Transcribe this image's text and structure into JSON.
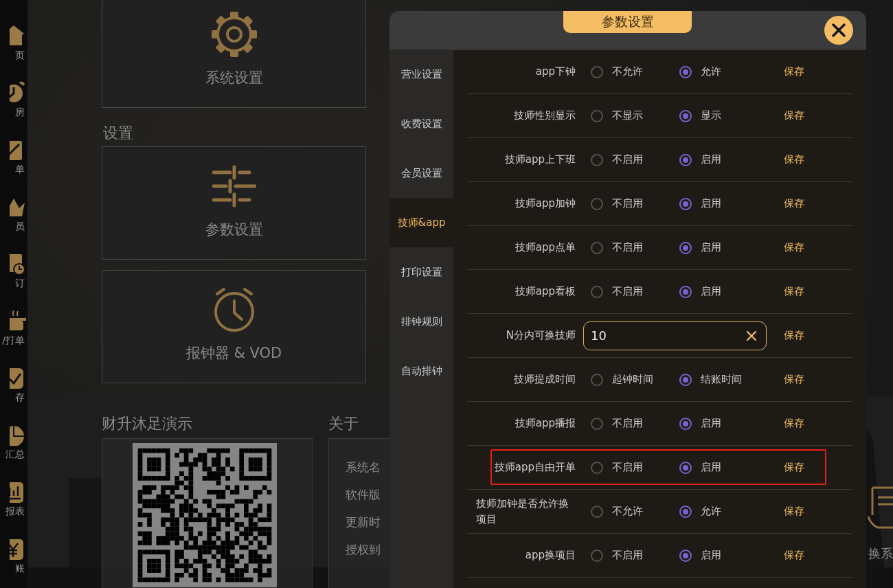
{
  "nav": [
    {
      "kind": "home",
      "label": "页"
    },
    {
      "kind": "clock",
      "label": "房"
    },
    {
      "kind": "clipboard",
      "label": "单"
    },
    {
      "kind": "crown",
      "label": "员"
    },
    {
      "kind": "calendar",
      "label": "订"
    },
    {
      "kind": "pot",
      "label": "/打单"
    },
    {
      "kind": "check",
      "label": "存"
    },
    {
      "kind": "pie",
      "label": "汇总"
    },
    {
      "kind": "report",
      "label": "报表"
    },
    {
      "kind": "yen",
      "label": "账"
    }
  ],
  "groups": [
    {
      "tiles": [
        {
          "kind": "gear",
          "label": "系统设置"
        }
      ]
    },
    {
      "title": "设置",
      "tiles": [
        {
          "kind": "sliders",
          "label": "参数设置"
        },
        {
          "kind": "alarm",
          "label": "报钟器 & VOD"
        }
      ]
    }
  ],
  "demo": {
    "title": "财升沐足演示"
  },
  "about": {
    "title": "关于",
    "lines": [
      "系统名",
      "软件版",
      "更新时",
      "授权到"
    ]
  },
  "edge_tile": {
    "label": "换系"
  },
  "dialog": {
    "title": "参数设置",
    "tabs": [
      {
        "label": "营业设置",
        "selected": false
      },
      {
        "label": "收费设置",
        "selected": false
      },
      {
        "label": "会员设置",
        "selected": false
      },
      {
        "label": "技师&app",
        "selected": true
      },
      {
        "label": "打印设置",
        "selected": false
      },
      {
        "label": "排钟规则",
        "selected": false
      },
      {
        "label": "自动排钟",
        "selected": false
      }
    ],
    "rows": [
      {
        "kind": "radio",
        "label": "app下钟",
        "options": [
          {
            "label": "不允许",
            "selected": false
          },
          {
            "label": "允许",
            "selected": true
          }
        ],
        "action": "保存",
        "highlighted": false
      },
      {
        "kind": "radio",
        "label": "技师性别显示",
        "options": [
          {
            "label": "不显示",
            "selected": false
          },
          {
            "label": "显示",
            "selected": true
          }
        ],
        "action": "保存",
        "highlighted": false
      },
      {
        "kind": "radio",
        "label": "技师app上下班",
        "options": [
          {
            "label": "不启用",
            "selected": false
          },
          {
            "label": "启用",
            "selected": true
          }
        ],
        "action": "保存",
        "highlighted": false
      },
      {
        "kind": "radio",
        "label": "技师app加钟",
        "options": [
          {
            "label": "不启用",
            "selected": false
          },
          {
            "label": "启用",
            "selected": true
          }
        ],
        "action": "保存",
        "highlighted": false
      },
      {
        "kind": "radio",
        "label": "技师app点单",
        "options": [
          {
            "label": "不启用",
            "selected": false
          },
          {
            "label": "启用",
            "selected": true
          }
        ],
        "action": "保存",
        "highlighted": false
      },
      {
        "kind": "radio",
        "label": "技师app看板",
        "options": [
          {
            "label": "不启用",
            "selected": false
          },
          {
            "label": "启用",
            "selected": true
          }
        ],
        "action": "保存",
        "highlighted": false
      },
      {
        "kind": "input",
        "label": "N分内可换技师",
        "value": "10",
        "action": "保存",
        "highlighted": false
      },
      {
        "kind": "radio",
        "label": "技师提成时间",
        "options": [
          {
            "label": "起钟时间",
            "selected": false
          },
          {
            "label": "结账时间",
            "selected": true
          }
        ],
        "action": "保存",
        "highlighted": false
      },
      {
        "kind": "radio",
        "label": "技师app播报",
        "options": [
          {
            "label": "不启用",
            "selected": false
          },
          {
            "label": "启用",
            "selected": true
          }
        ],
        "action": "保存",
        "highlighted": false
      },
      {
        "kind": "radio",
        "label": "技师app自由开单",
        "options": [
          {
            "label": "不启用",
            "selected": false
          },
          {
            "label": "启用",
            "selected": true
          }
        ],
        "action": "保存",
        "highlighted": true
      },
      {
        "kind": "radio",
        "label": "技师加钟是否允许换项目",
        "options": [
          {
            "label": "不允许",
            "selected": false
          },
          {
            "label": "允许",
            "selected": true
          }
        ],
        "action": "保存",
        "highlighted": false
      },
      {
        "kind": "radio",
        "label": "app换项目",
        "options": [
          {
            "label": "不启用",
            "selected": false
          },
          {
            "label": "启用",
            "selected": true
          }
        ],
        "action": "保存",
        "highlighted": false
      }
    ]
  }
}
